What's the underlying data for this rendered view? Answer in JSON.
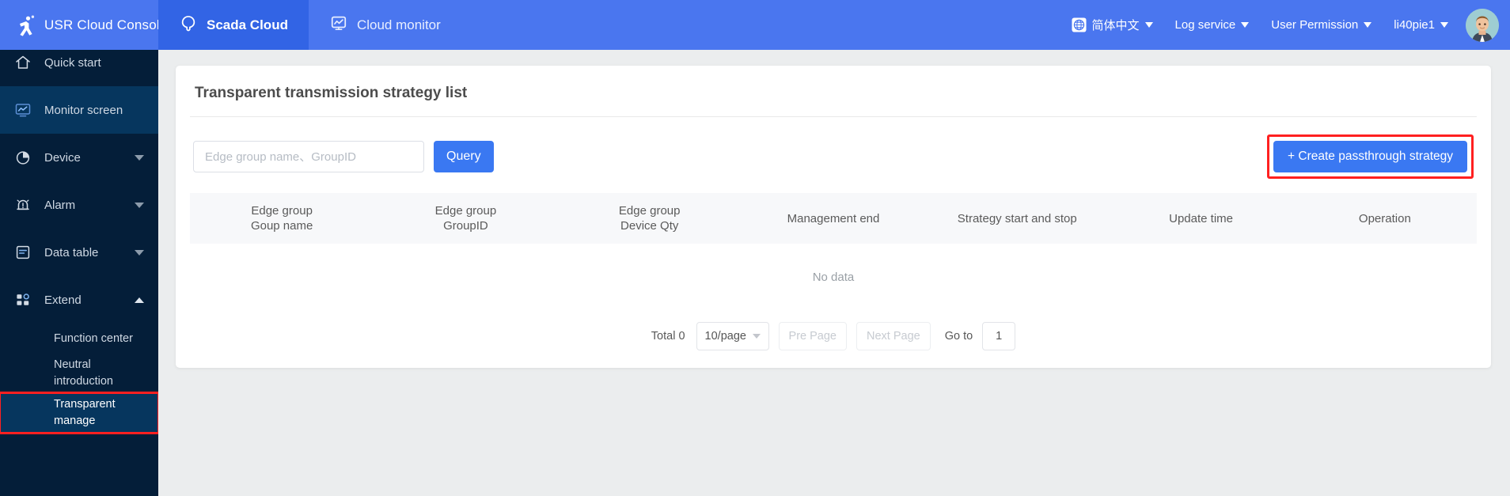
{
  "topbar": {
    "brand_title": "USR Cloud Console",
    "logo_icon": "person-running-icon",
    "menu_icon": "hamburger-menu-icon",
    "tabs": [
      {
        "label": "Scada Cloud",
        "icon": "cloud-icon",
        "active": true
      },
      {
        "label": "Cloud monitor",
        "icon": "monitor-chart-icon",
        "active": false
      }
    ],
    "right_items": [
      {
        "label": "简体中文",
        "icon": "globe-icon",
        "caret": true
      },
      {
        "label": "Log service",
        "icon": "",
        "caret": true
      },
      {
        "label": "User Permission",
        "icon": "",
        "caret": true
      },
      {
        "label": "li40pie1",
        "icon": "",
        "caret": true
      }
    ],
    "avatar_icon": "user-avatar-icon",
    "accent_color": "#4a76ef",
    "active_tab_color": "#3264e5"
  },
  "sidebar": {
    "background_color": "#041e39",
    "selected_color": "#06365e",
    "items": [
      {
        "label": "Quick start",
        "icon": "home-icon",
        "arrow": "",
        "selected": false
      },
      {
        "label": "Monitor screen",
        "icon": "monitor-icon",
        "arrow": "",
        "selected": true
      },
      {
        "label": "Device",
        "icon": "pie-clock-icon",
        "arrow": "down",
        "selected": false
      },
      {
        "label": "Alarm",
        "icon": "bell-alarm-icon",
        "arrow": "down",
        "selected": false
      },
      {
        "label": "Data table",
        "icon": "data-table-icon",
        "arrow": "down",
        "selected": false
      },
      {
        "label": "Extend",
        "icon": "grid-blocks-icon",
        "arrow": "up",
        "selected": false
      }
    ],
    "sub_items": [
      {
        "label": "Function center",
        "active": false,
        "highlighted": false
      },
      {
        "label": "Neutral introduction",
        "active": false,
        "highlighted": false
      },
      {
        "label": "Transparent manage",
        "active": true,
        "highlighted": true
      }
    ],
    "highlight_color": "#ff2020"
  },
  "main": {
    "card_title": "Transparent transmission strategy list",
    "toolbar": {
      "search_placeholder": "Edge group name、GroupID",
      "search_value": "",
      "query_label": "Query",
      "create_label": "+ Create passthrough strategy",
      "create_highlighted": true
    },
    "table": {
      "columns": [
        {
          "line1": "Edge group",
          "line2": "Goup name"
        },
        {
          "line1": "Edge group",
          "line2": "GroupID"
        },
        {
          "line1": "Edge group",
          "line2": "Device Qty"
        },
        {
          "line1": "Management end",
          "line2": ""
        },
        {
          "line1": "Strategy start and stop",
          "line2": ""
        },
        {
          "line1": "Update time",
          "line2": ""
        },
        {
          "line1": "Operation",
          "line2": ""
        }
      ],
      "rows": [],
      "empty_text": "No data"
    },
    "pagination": {
      "total_label": "Total 0",
      "page_size_label": "10/page",
      "prev_label": "Pre Page",
      "next_label": "Next Page",
      "goto_label": "Go to",
      "current_page": "1"
    }
  }
}
